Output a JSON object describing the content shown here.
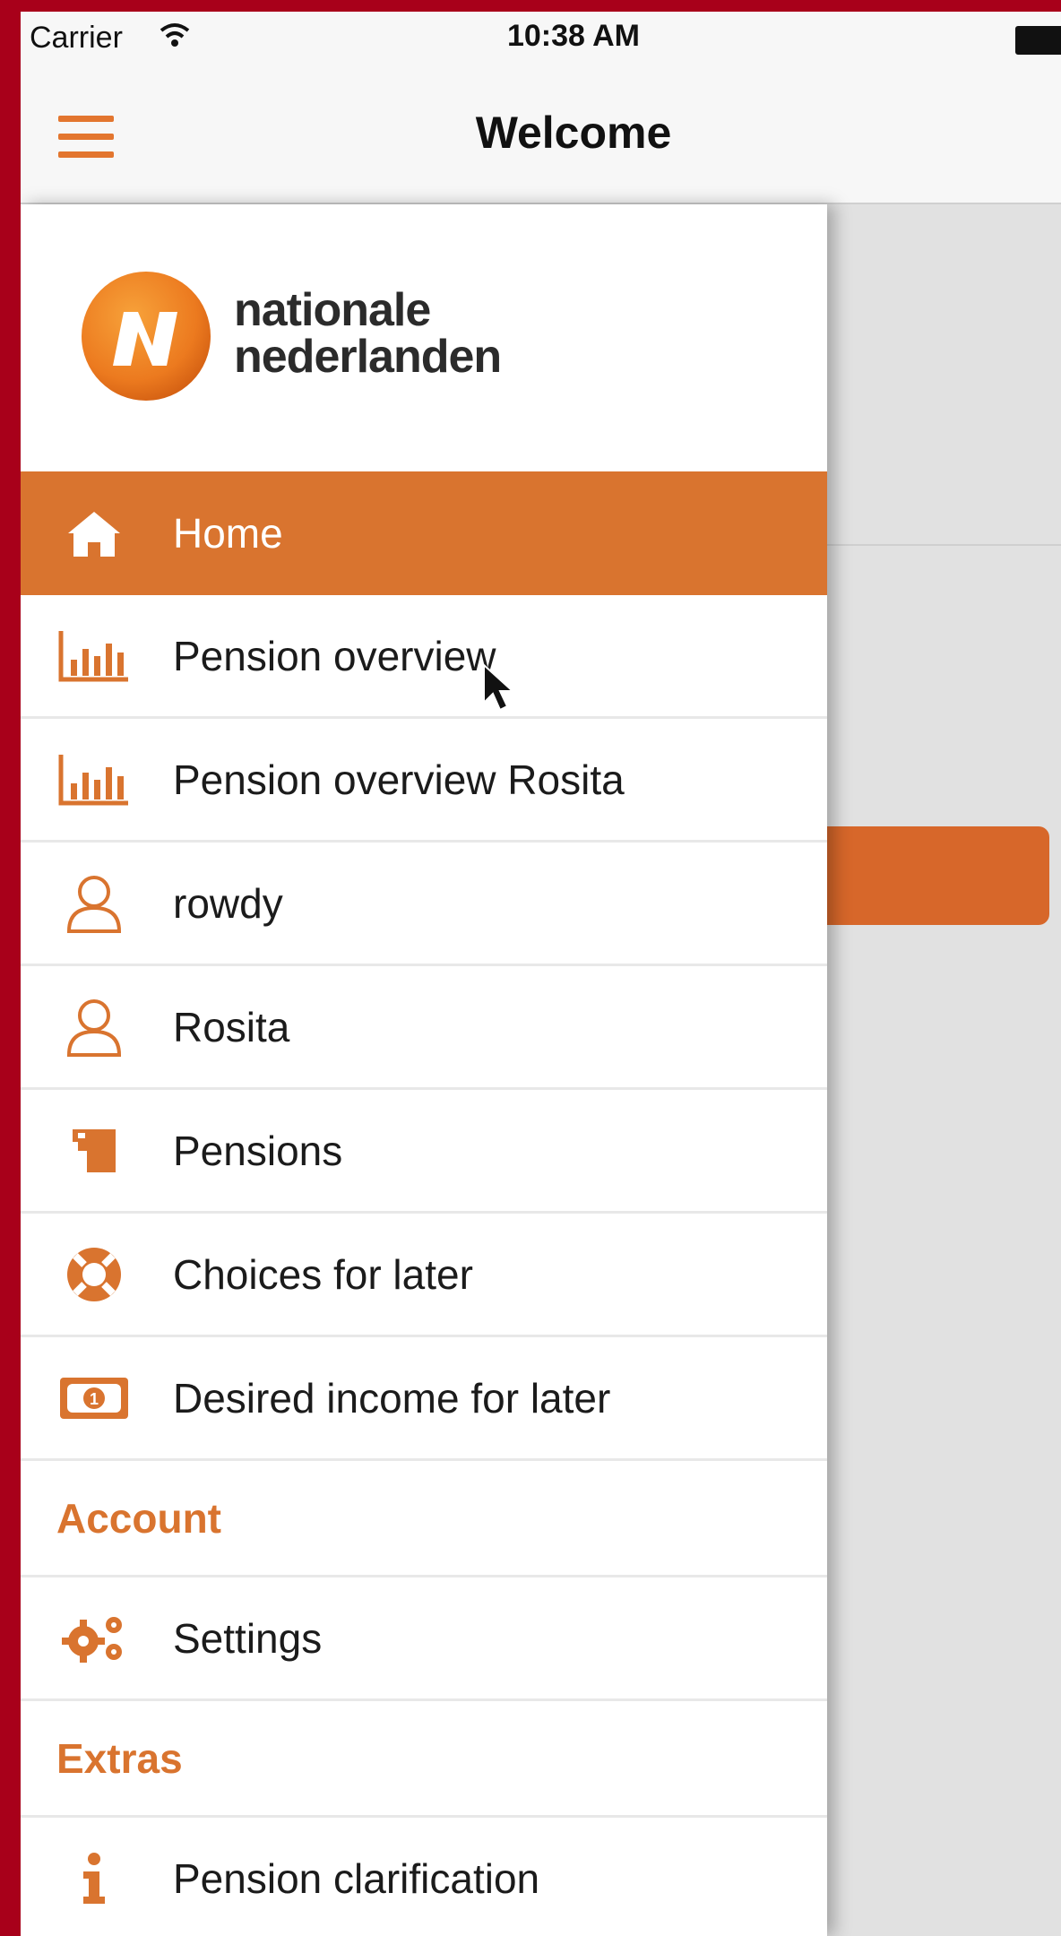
{
  "status_bar": {
    "carrier": "Carrier",
    "time": "10:38 AM"
  },
  "nav_bar": {
    "title": "Welcome",
    "menu_icon": "hamburger-icon"
  },
  "drawer": {
    "logo": {
      "line1": "nationale",
      "line2": "nederlanden"
    },
    "items": [
      {
        "label": "Home",
        "icon": "home-icon",
        "active": true
      },
      {
        "label": "Pension overview",
        "icon": "bar-chart-icon"
      },
      {
        "label": "Pension overview Rosita",
        "icon": "bar-chart-icon"
      },
      {
        "label": "rowdy",
        "icon": "user-icon"
      },
      {
        "label": "Rosita",
        "icon": "user-icon"
      },
      {
        "label": "Pensions",
        "icon": "pension-icon"
      },
      {
        "label": "Choices for later",
        "icon": "lifebuoy-icon"
      },
      {
        "label": "Desired income for later",
        "icon": "banknote-icon"
      }
    ],
    "account_section": {
      "title": "Account",
      "items": [
        {
          "label": "Settings",
          "icon": "gears-icon"
        }
      ]
    },
    "extras_section": {
      "title": "Extras",
      "items": [
        {
          "label": "Pension clarification",
          "icon": "info-icon"
        }
      ]
    }
  },
  "colors": {
    "accent": "#d9742f",
    "frame": "#a8001a",
    "background": "#e1e1e1"
  }
}
